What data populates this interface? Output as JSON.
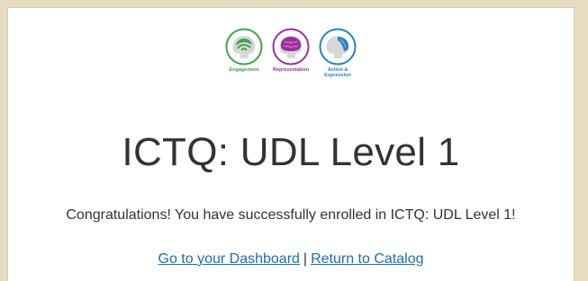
{
  "colors": {
    "engagement": "#3fa34d",
    "representation": "#9c2fa0",
    "action_expression": "#2b7fc3",
    "link": "#1a6fb5"
  },
  "logos": [
    {
      "icon": "engagement-brain-icon",
      "label": "Engagement"
    },
    {
      "icon": "representation-brain-icon",
      "label": "Representation"
    },
    {
      "icon": "action-expression-brain-icon",
      "label": "Action &\nExpression"
    }
  ],
  "title": "ICTQ: UDL Level 1",
  "message": "Congratulations! You have successfully enrolled in ICTQ: UDL Level 1!",
  "links": {
    "dashboard": "Go to your Dashboard",
    "separator": "|",
    "catalog": "Return to Catalog"
  }
}
